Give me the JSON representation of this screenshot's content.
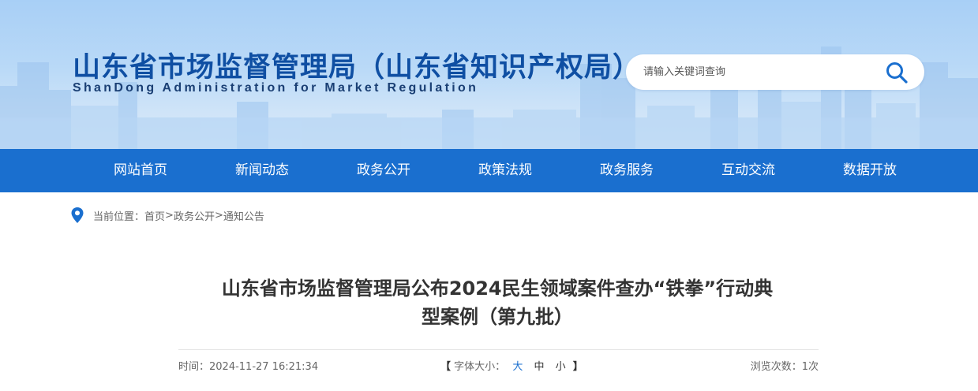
{
  "header": {
    "site_title": "山东省市场监督管理局（山东省知识产权局）",
    "site_subtitle": "ShanDong Administration for Market Regulation",
    "search_placeholder": "请输入关键词查询",
    "brand_color": "#1a6fcf",
    "title_color": "#0f4fa3"
  },
  "nav": {
    "items": [
      "网站首页",
      "新闻动态",
      "政务公开",
      "政策法规",
      "政务服务",
      "互动交流",
      "数据开放"
    ]
  },
  "breadcrumb": {
    "prefix": "当前位置：",
    "items": [
      "首页",
      "政务公开",
      "通知公告"
    ],
    "separator": ">"
  },
  "article": {
    "title_line1": "山东省市场监督管理局公布2024民生领域案件查办“铁拳”行动典",
    "title_line2": "型案例（第九批）",
    "time_label": "时间：",
    "time_value": "2024-11-27 16:21:34",
    "font_size_label": "字体大小：",
    "font_size_options": [
      "大",
      "中",
      "小"
    ],
    "bracket_open": "【",
    "bracket_close": "】",
    "views_label": "浏览次数：",
    "views_value": "1次"
  },
  "icons": {
    "search": "search-icon",
    "location": "location-pin-icon"
  }
}
